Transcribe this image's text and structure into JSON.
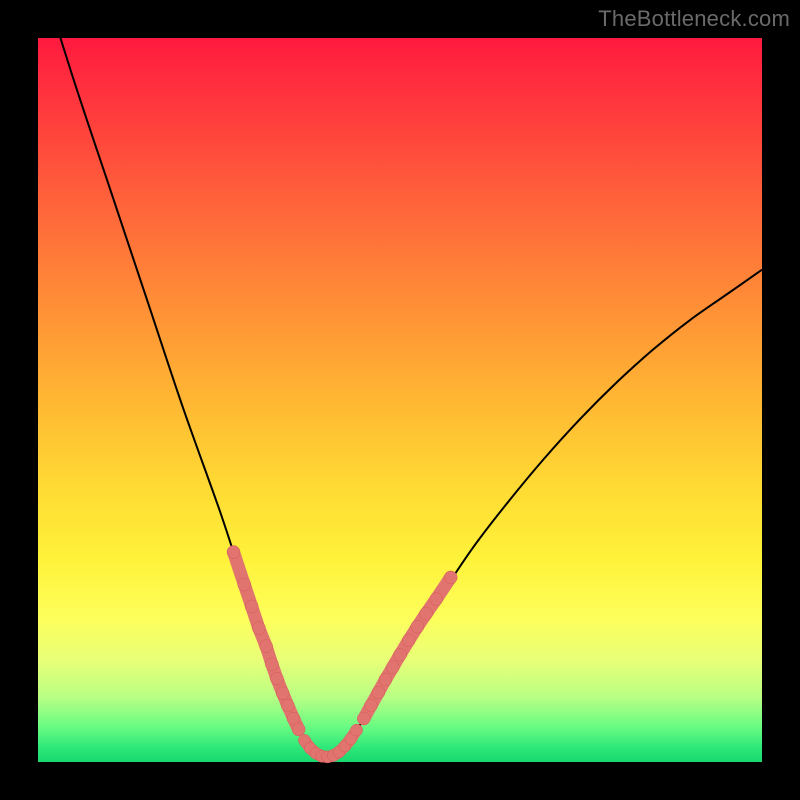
{
  "watermark": "TheBottleneck.com",
  "colors": {
    "background": "#000000",
    "curve": "#000000",
    "marker_fill": "#e2746f",
    "marker_stroke": "#d35a55"
  },
  "chart_data": {
    "type": "line",
    "title": "",
    "xlabel": "",
    "ylabel": "",
    "xlim": [
      0,
      100
    ],
    "ylim": [
      0,
      100
    ],
    "series": [
      {
        "name": "curve",
        "x": [
          0,
          5,
          10,
          15,
          20,
          25,
          28,
          31,
          33,
          35,
          36.5,
          38,
          39.5,
          41,
          43,
          46,
          50,
          55,
          60,
          65,
          70,
          75,
          80,
          85,
          90,
          95,
          100
        ],
        "y": [
          110,
          94,
          79,
          64,
          49,
          35,
          26,
          18,
          12,
          7,
          3.5,
          1.5,
          0.7,
          1.2,
          3,
          7.5,
          14,
          22,
          29.5,
          36,
          42,
          47.5,
          52.5,
          57,
          61,
          64.5,
          68
        ],
        "note": "y is chart-space percentage above bottom; values outside ylim are clipped by the black frame"
      }
    ],
    "markers": {
      "left_segment": {
        "points": [
          {
            "x": 27.0,
            "y": 29.0
          },
          {
            "x": 28.5,
            "y": 24.5
          },
          {
            "x": 29.5,
            "y": 21.5
          },
          {
            "x": 30.5,
            "y": 18.5
          },
          {
            "x": 31.5,
            "y": 16.0
          },
          {
            "x": 32.3,
            "y": 13.5
          },
          {
            "x": 33.0,
            "y": 11.5
          },
          {
            "x": 33.8,
            "y": 9.5
          },
          {
            "x": 34.5,
            "y": 7.8
          },
          {
            "x": 35.3,
            "y": 6.0
          },
          {
            "x": 36.0,
            "y": 4.5
          }
        ]
      },
      "bottom_segment": {
        "points": [
          {
            "x": 36.8,
            "y": 3.0
          },
          {
            "x": 37.6,
            "y": 1.9
          },
          {
            "x": 38.4,
            "y": 1.2
          },
          {
            "x": 39.2,
            "y": 0.8
          },
          {
            "x": 40.0,
            "y": 0.7
          },
          {
            "x": 40.8,
            "y": 0.9
          },
          {
            "x": 41.6,
            "y": 1.4
          },
          {
            "x": 42.4,
            "y": 2.2
          },
          {
            "x": 43.2,
            "y": 3.2
          },
          {
            "x": 44.0,
            "y": 4.4
          }
        ]
      },
      "right_segment": {
        "points": [
          {
            "x": 45.0,
            "y": 6.0
          },
          {
            "x": 46.0,
            "y": 7.8
          },
          {
            "x": 47.0,
            "y": 9.6
          },
          {
            "x": 48.0,
            "y": 11.4
          },
          {
            "x": 49.0,
            "y": 13.1
          },
          {
            "x": 50.0,
            "y": 14.8
          },
          {
            "x": 51.2,
            "y": 16.8
          },
          {
            "x": 52.4,
            "y": 18.7
          },
          {
            "x": 53.6,
            "y": 20.5
          },
          {
            "x": 55.0,
            "y": 22.5
          },
          {
            "x": 57.0,
            "y": 25.5
          }
        ]
      }
    }
  }
}
